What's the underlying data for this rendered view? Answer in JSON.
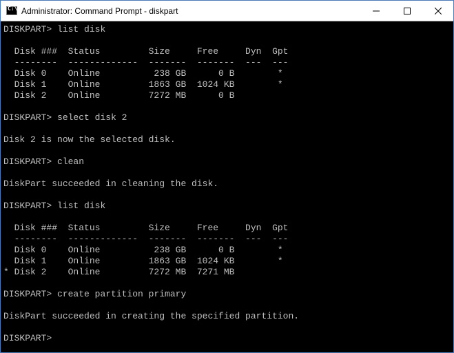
{
  "titlebar": {
    "title": "Administrator: Command Prompt - diskpart",
    "icon_name": "cmd-icon"
  },
  "window_controls": {
    "minimize": "minimize",
    "maximize": "maximize",
    "close": "close"
  },
  "terminal": {
    "prompt": "DISKPART>",
    "commands": {
      "cmd1": "list disk",
      "cmd2": "select disk 2",
      "cmd3": "clean",
      "cmd4": "list disk",
      "cmd5": "create partition primary",
      "cmd6": ""
    },
    "table1": {
      "header": "  Disk ###  Status         Size     Free     Dyn  Gpt",
      "divider": "  --------  -------------  -------  -------  ---  ---",
      "rows": [
        "  Disk 0    Online          238 GB      0 B        *",
        "  Disk 1    Online         1863 GB  1024 KB        *",
        "  Disk 2    Online         7272 MB      0 B"
      ]
    },
    "msg_select": "Disk 2 is now the selected disk.",
    "msg_clean": "DiskPart succeeded in cleaning the disk.",
    "table2": {
      "header": "  Disk ###  Status         Size     Free     Dyn  Gpt",
      "divider": "  --------  -------------  -------  -------  ---  ---",
      "rows": [
        "  Disk 0    Online          238 GB      0 B        *",
        "  Disk 1    Online         1863 GB  1024 KB        *",
        "* Disk 2    Online         7272 MB  7271 MB"
      ]
    },
    "msg_create": "DiskPart succeeded in creating the specified partition."
  }
}
